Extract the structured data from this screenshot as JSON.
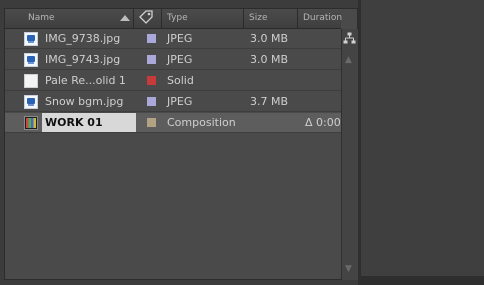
{
  "columns": {
    "name": "Name",
    "type": "Type",
    "size": "Size",
    "duration": "Duration"
  },
  "items": [
    {
      "name": "IMG_9738.jpg",
      "type": "JPEG",
      "size": "3.0 MB",
      "duration": "",
      "label_color": "#aaa8d8",
      "icon": "image-icon"
    },
    {
      "name": "IMG_9743.jpg",
      "type": "JPEG",
      "size": "3.0 MB",
      "duration": "",
      "label_color": "#aaa8d8",
      "icon": "image-icon"
    },
    {
      "name": "Pale Re...olid 1",
      "type": "Solid",
      "size": "",
      "duration": "",
      "label_color": "#c73a3a",
      "icon": "solid-icon"
    },
    {
      "name": "Snow bgm.jpg",
      "type": "JPEG",
      "size": "3.7 MB",
      "duration": "",
      "label_color": "#aaa8d8",
      "icon": "image-icon"
    },
    {
      "name": "WORK 01",
      "type": "Composition",
      "size": "",
      "duration": "Δ 0:00",
      "label_color": "#b3a184",
      "icon": "composition-icon",
      "selected": true
    }
  ],
  "icons": {
    "sort": "sort-ascending-icon",
    "label": "label-tag-icon",
    "flowchart": "flowchart-icon"
  }
}
